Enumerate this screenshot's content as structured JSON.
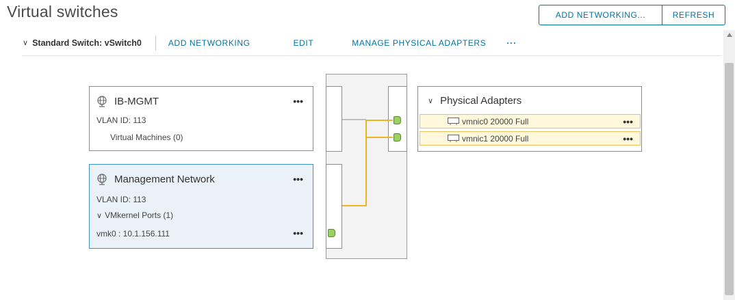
{
  "page": {
    "title": "Virtual switches"
  },
  "toolbar": {
    "add_networking": "ADD NETWORKING...",
    "refresh": "REFRESH"
  },
  "switch": {
    "title": "Standard Switch: vSwitch0",
    "add_networking": "ADD NETWORKING",
    "edit": "EDIT",
    "manage_physical_adapters": "MANAGE PHYSICAL ADAPTERS",
    "more": "···"
  },
  "port_groups": [
    {
      "name": "IB-MGMT",
      "vlan": "VLAN ID: 113",
      "detail": "Virtual Machines (0)",
      "more": "•••"
    },
    {
      "name": "Management Network",
      "vlan": "VLAN ID: 113",
      "detail": "VMkernel Ports (1)",
      "vmk": "vmk0 : 10.1.156.111",
      "more": "•••",
      "vmk_more": "•••",
      "selected": true
    }
  ],
  "physical_adapters": {
    "title": "Physical Adapters",
    "items": [
      {
        "label": "vmnic0 20000 Full",
        "more": "•••"
      },
      {
        "label": "vmnic1 20000 Full",
        "more": "•••"
      }
    ]
  },
  "colors": {
    "accent": "#0072a3",
    "wire": "#f0b41e",
    "port": "#9bd161",
    "selected_bg": "#eaf1f8"
  },
  "icons": {
    "network": "network-globe-icon",
    "nic": "nic-adapter-icon",
    "chevron": "chevron-down-icon"
  }
}
